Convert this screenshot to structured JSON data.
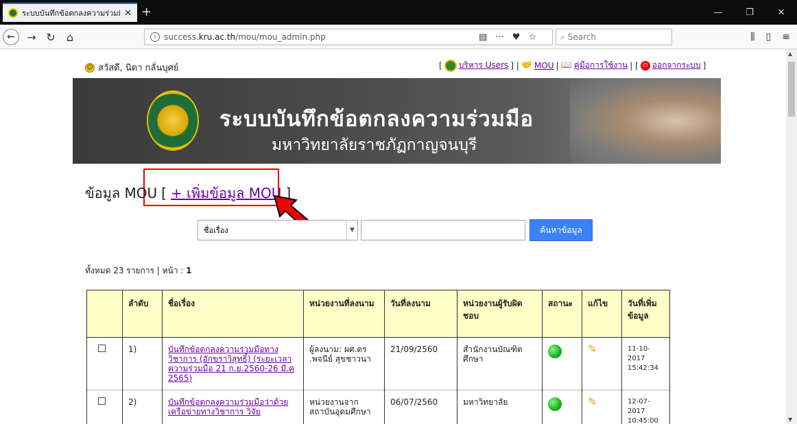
{
  "browser": {
    "tab_title": "ระบบบันทึกข้อตกลงความร่วมมือ :",
    "tab_close": "✕",
    "new_tab": "+",
    "url_host": "success.kru.ac.th",
    "url_path": "/mou/mou_admin.php",
    "url_prefix": "success.",
    "url_bold": "kru.ac.th",
    "search_placeholder": "Search"
  },
  "header": {
    "greeting": "สวัสดี, นิดา กลั่นบุศย์",
    "menu": {
      "bracket_open": "[",
      "users_label": "บริหาร Users",
      "sep1": "] |",
      "mou_label": "MOU",
      "sep2": "|",
      "manual_label": "คู่มือการใช้งาน",
      "sep3": "| [",
      "logout_label": "ออกจากระบบ",
      "bracket_close": "]"
    }
  },
  "banner": {
    "title": "ระบบบันทึกข้อตกลงความร่วมมือ",
    "subtitle": "มหาวิทยาลัยราชภัฏกาญจนบุรี"
  },
  "section": {
    "title": "ข้อมูล MOU",
    "bracket_open": "[",
    "add_label": "+ เพิ่มข้อมูล MOU",
    "bracket_close": "]"
  },
  "filter": {
    "selected": "ชื่อเรื่อง",
    "button_label": "ค้นหาข้อมูล"
  },
  "summary": {
    "text": "ทั้งหมด 23 รายการ | หน้า : ",
    "page": "1"
  },
  "table": {
    "headers": [
      "",
      "ลำดับ",
      "ชื่อเรื่อง",
      "หน่วยงานที่ลงนาม",
      "วันที่ลงนาม",
      "หน่วยงานผู้รับผิดชอบ",
      "สถานะ",
      "แก้ไข",
      "วันที่เพิ่มข้อมูล"
    ],
    "rows": [
      {
        "no": "1)",
        "title": "บันทึกข้อตกลงความร่วมมือทางวิชาการ (อักขราวิสุทธิ์) (ระยะเวลาความร่วมมือ 21 ก.ย.2560-26 มี.ค 2565)",
        "org": "ผู้ลงนาม: ผศ.ดร .พจนีย์ สุขชาวนา",
        "date": "21/09/2560",
        "owner": "สำนักงานบัณฑิตศึกษา",
        "added_date": "11-10-2017",
        "added_time": "15:42:34"
      },
      {
        "no": "2)",
        "title": "บันทึกข้อตกลงความร่วมมือว่าด้วยเครือข่ายทางวิชาการ วิจัย",
        "org": "หน่วยงานจาก สถาบันอุดมศึกษา",
        "date": "06/07/2560",
        "owner": "มหาวิทยาลัย",
        "added_date": "12-07-2017",
        "added_time": "10:45:00"
      }
    ]
  }
}
